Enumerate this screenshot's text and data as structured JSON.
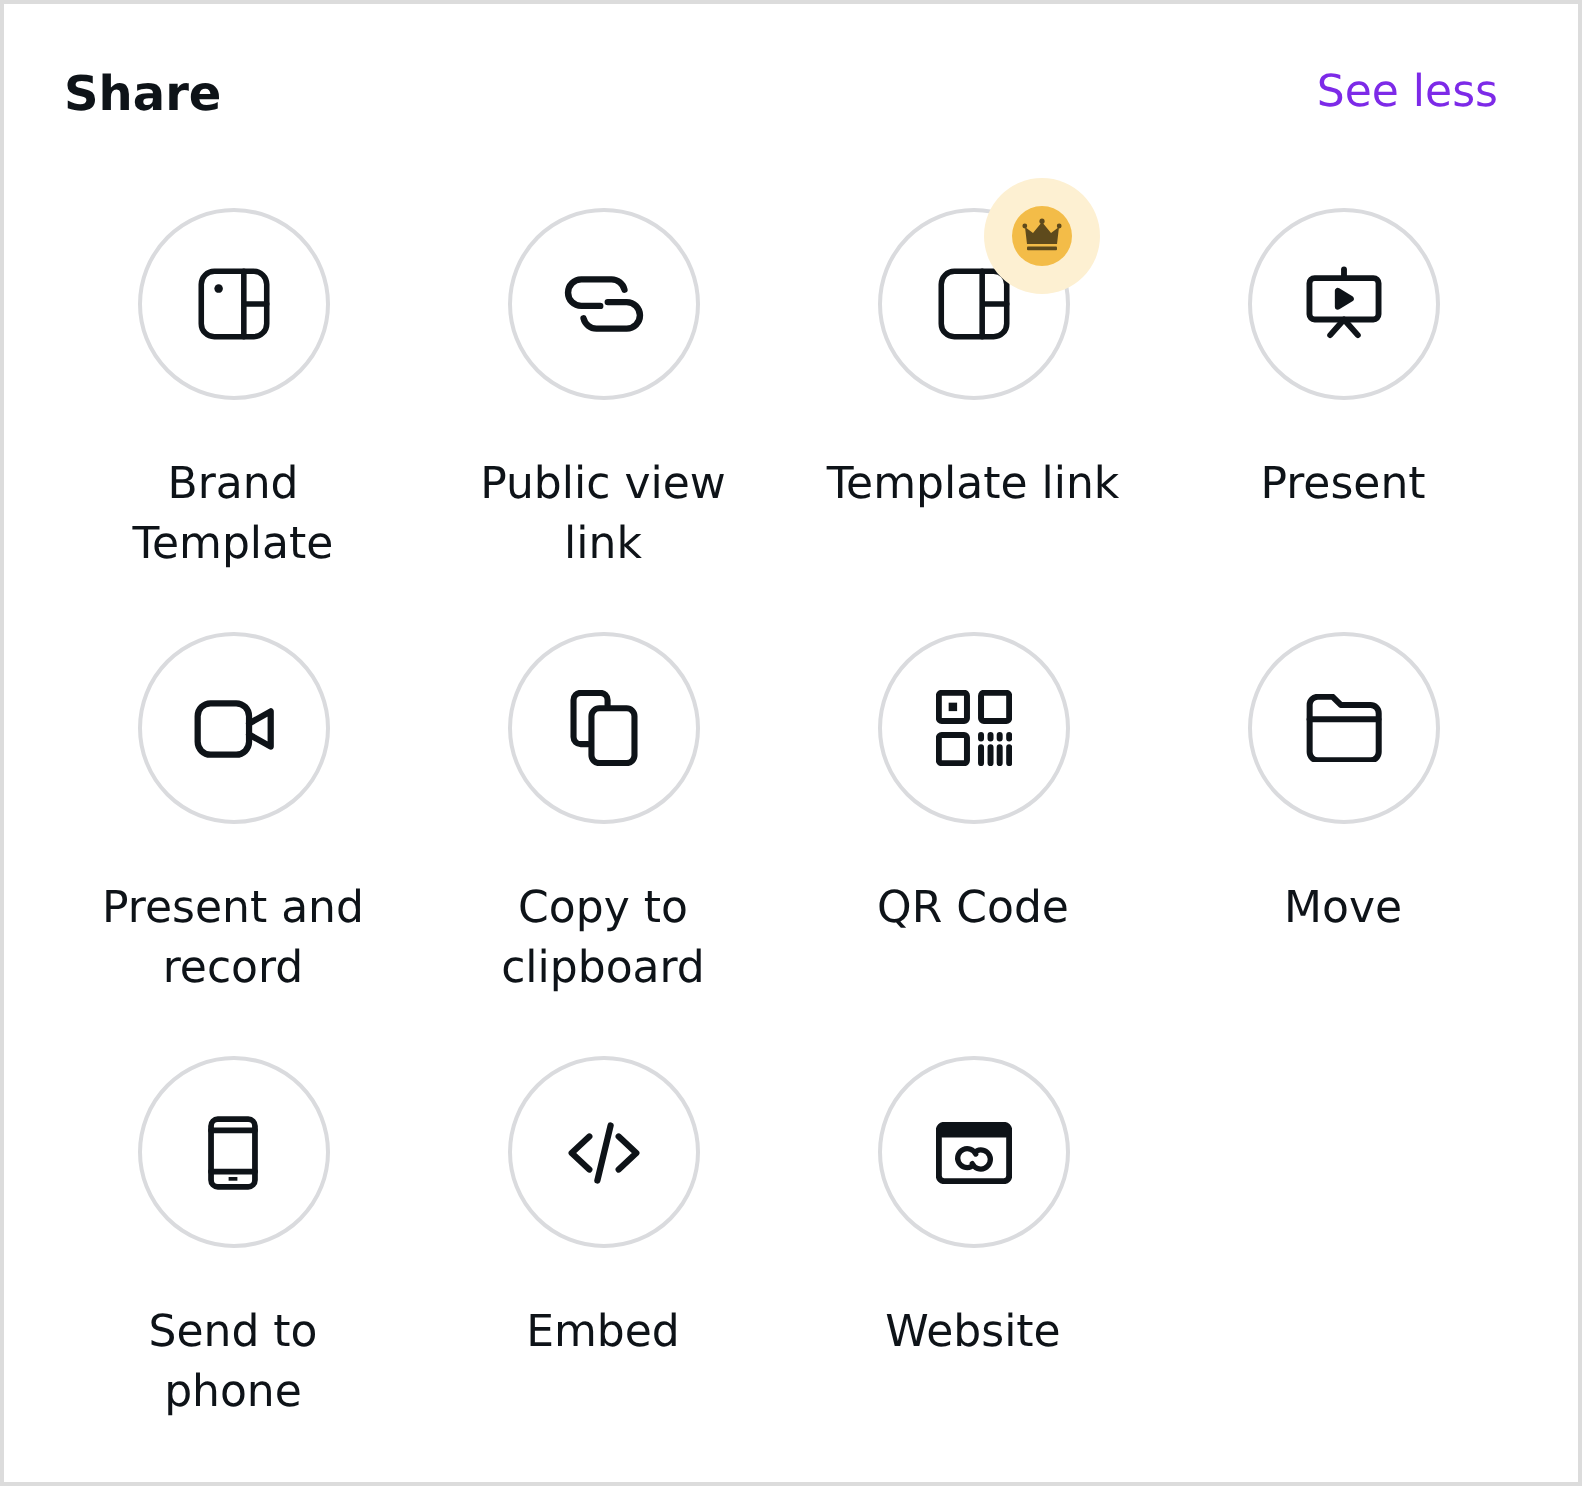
{
  "header": {
    "title": "Share",
    "action": "See less"
  },
  "options": [
    {
      "kind": "brand_template",
      "label": "Brand Template",
      "premium": false
    },
    {
      "kind": "link",
      "label": "Public view link",
      "premium": false
    },
    {
      "kind": "template",
      "label": "Template link",
      "premium": true
    },
    {
      "kind": "present",
      "label": "Present",
      "premium": false
    },
    {
      "kind": "video",
      "label": "Present and record",
      "premium": false
    },
    {
      "kind": "copy",
      "label": "Copy to clipboard",
      "premium": false
    },
    {
      "kind": "qr",
      "label": "QR Code",
      "premium": false
    },
    {
      "kind": "folder",
      "label": "Move",
      "premium": false
    },
    {
      "kind": "phone",
      "label": "Send to phone",
      "premium": false
    },
    {
      "kind": "embed",
      "label": "Embed",
      "premium": false
    },
    {
      "kind": "website",
      "label": "Website",
      "premium": false
    }
  ]
}
